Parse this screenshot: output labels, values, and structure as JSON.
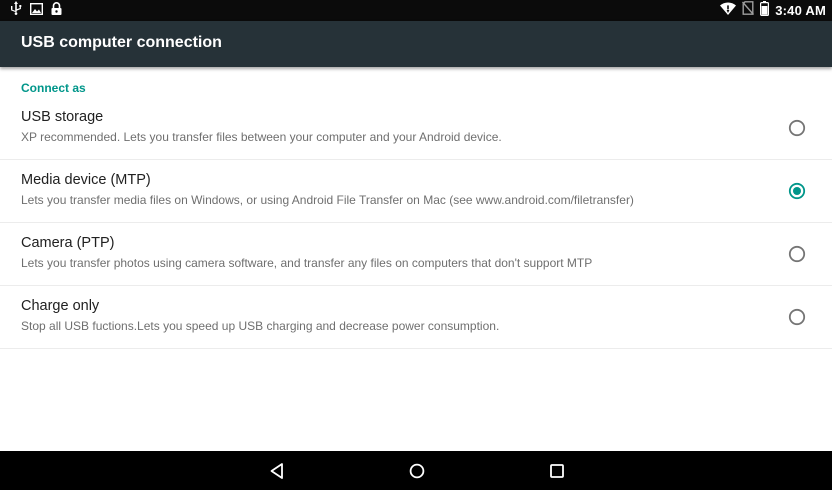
{
  "status_bar": {
    "time": "3:40 AM",
    "left_icons": [
      "usb-icon",
      "image-icon",
      "lock-icon"
    ],
    "right_icons": [
      "wifi-icon",
      "no-sim-icon",
      "battery-icon"
    ]
  },
  "app_bar": {
    "title": "USB computer connection"
  },
  "section": {
    "header": "Connect as"
  },
  "options": [
    {
      "title": "USB storage",
      "summary": "XP recommended. Lets you transfer files between your computer and your Android device.",
      "selected": false
    },
    {
      "title": "Media device (MTP)",
      "summary": "Lets you transfer media files on Windows, or using Android File Transfer on Mac (see www.android.com/filetransfer)",
      "selected": true
    },
    {
      "title": "Camera (PTP)",
      "summary": "Lets you transfer photos using camera software, and transfer any files on computers that don't support MTP",
      "selected": false
    },
    {
      "title": "Charge only",
      "summary": "Stop all USB fuctions.Lets you speed up USB charging and decrease power consumption.",
      "selected": false
    }
  ],
  "nav_bar": {
    "buttons": [
      "back-icon",
      "home-icon",
      "recents-icon"
    ]
  },
  "colors": {
    "status_bar": "#0b0b0b",
    "app_bar": "#263238",
    "accent": "#00968a",
    "radio_unchecked": "#757575",
    "nav_bar": "#000000"
  }
}
